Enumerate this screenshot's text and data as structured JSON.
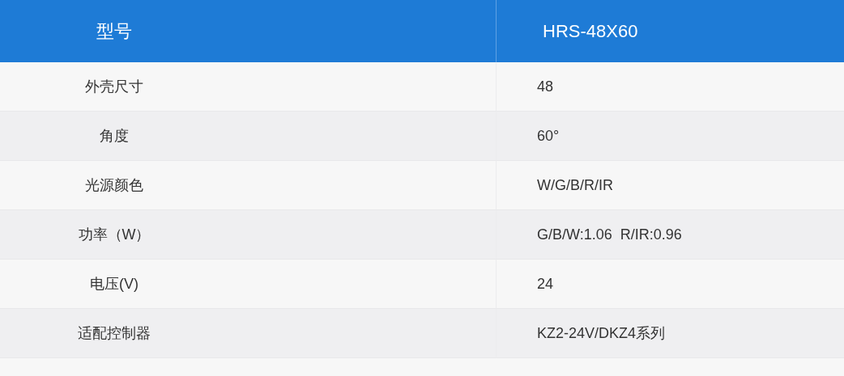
{
  "table": {
    "header": [
      "型号",
      "HRS-48X60"
    ],
    "rows": [
      {
        "label": "外壳尺寸",
        "value": "48"
      },
      {
        "label": "角度",
        "value": "60°"
      },
      {
        "label": "光源颜色",
        "value": "W/G/B/R/IR"
      },
      {
        "label": "功率（W）",
        "value": "G/B/W:1.06  R/IR:0.96"
      },
      {
        "label": "电压(V)",
        "value": "24"
      },
      {
        "label": "适配控制器",
        "value": "KZ2-24V/DKZ4系列"
      }
    ]
  }
}
